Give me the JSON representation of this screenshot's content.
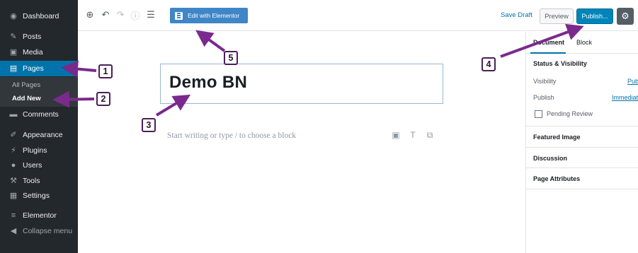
{
  "sidebar": {
    "items": [
      {
        "label": "Dashboard",
        "icon": "dashboard-icon",
        "glyph": "◉"
      },
      {
        "label": "Posts",
        "icon": "pin-icon",
        "glyph": "✎"
      },
      {
        "label": "Media",
        "icon": "media-icon",
        "glyph": "▣"
      },
      {
        "label": "Pages",
        "icon": "pages-icon",
        "glyph": "▤"
      },
      {
        "label": "Comments",
        "icon": "comment-icon",
        "glyph": "▬"
      },
      {
        "label": "Appearance",
        "icon": "paintbrush-icon",
        "glyph": "✐"
      },
      {
        "label": "Plugins",
        "icon": "plug-icon",
        "glyph": "⚡"
      },
      {
        "label": "Users",
        "icon": "user-icon",
        "glyph": "●"
      },
      {
        "label": "Tools",
        "icon": "wrench-icon",
        "glyph": "⚒"
      },
      {
        "label": "Settings",
        "icon": "settings-icon",
        "glyph": "▦"
      },
      {
        "label": "Elementor",
        "icon": "elementor-icon",
        "glyph": "≡"
      }
    ],
    "submenu": {
      "all_pages": "All Pages",
      "add_new": "Add New"
    },
    "collapse_label": "Collapse menu",
    "colors": {
      "background": "#23282d",
      "active": "#0073aa"
    }
  },
  "toolbar": {
    "edit_with_elementor": "Edit with Elementor",
    "save_draft": "Save Draft",
    "preview": "Preview",
    "publish": "Publish...",
    "icons": {
      "add": "⊕",
      "undo": "↶",
      "redo": "↷",
      "info": "ⓘ",
      "outline": "☰",
      "gear": "⚙"
    }
  },
  "editor": {
    "title": "Demo BN",
    "placeholder": "Start writing or type / to choose a block",
    "inserter_icons": {
      "image": "▣",
      "heading": "T",
      "gallery": "⧉"
    }
  },
  "panel": {
    "tabs": {
      "document": "Document",
      "block": "Block"
    },
    "status_visibility": "Status & Visibility",
    "visibility_label": "Visibility",
    "visibility_value": "Publi",
    "publish_label": "Publish",
    "publish_value": "Immediate",
    "pending_review": "Pending Review",
    "featured_image": "Featured Image",
    "discussion": "Discussion",
    "page_attributes": "Page Attributes"
  },
  "annotations": {
    "badges": [
      "1",
      "2",
      "3",
      "4",
      "5"
    ],
    "color": "#7a2a8c"
  }
}
